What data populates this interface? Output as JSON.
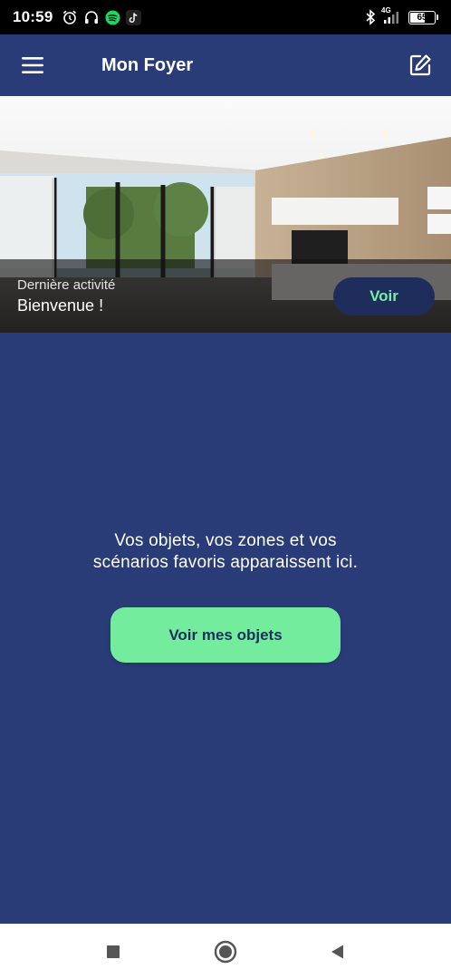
{
  "status_bar": {
    "time": "10:59",
    "network": "4G",
    "battery": "65",
    "battery_level": 0.65,
    "left_icons": [
      "alarm-icon",
      "headphones-icon",
      "spotify-icon",
      "tiktok-icon"
    ],
    "right_icons": [
      "bluetooth-icon",
      "signal-icon",
      "battery-icon"
    ]
  },
  "app_bar": {
    "title": "Mon Foyer",
    "menu_icon": "hamburger-menu-icon",
    "edit_icon": "edit-icon"
  },
  "hero": {
    "label": "Dernière activité",
    "value": "Bienvenue !",
    "button_label": "Voir"
  },
  "empty_state": {
    "line1": "Vos objets, vos zones et vos",
    "line2": "scénarios favoris apparaissent ici.",
    "button_label": "Voir mes objets"
  },
  "nav_bar": {
    "items": [
      "recents-square-icon",
      "home-circle-icon",
      "back-triangle-icon"
    ]
  },
  "colors": {
    "background": "#2a3c78",
    "accent_green": "#74ec9e",
    "dark_button": "#1f2d5d",
    "status_bar": "#000000"
  }
}
